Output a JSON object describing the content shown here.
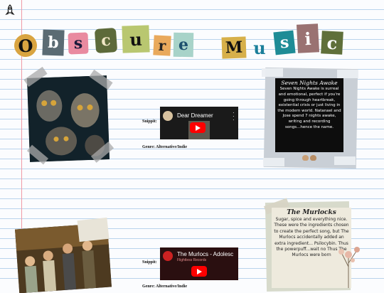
{
  "title": {
    "word1": [
      "O",
      "b",
      "s",
      "c",
      "u",
      "r",
      "e"
    ],
    "word2": [
      "M",
      "u",
      "s",
      "i",
      "c"
    ]
  },
  "entries": [
    {
      "snippet_label": "Snippit:",
      "genre_label": "Genre: Alternative/Indie",
      "video_title": "Dear Dreamer",
      "video_channel": "",
      "card_title": "Seven Nights Awake",
      "card_text": "Seven Nights Awake is surreal and emotional, perfect if you're going through heartbreak, existential crisis or just living in the modern world. Natanael and Jose spend 7 nights awake, writing and recording songs...hence the name."
    },
    {
      "snippet_label": "Snippit:",
      "genre_label": "Genre: Alternative/Indie",
      "video_title": "The Murlocs - Adolesc",
      "video_channel": "Flightless Records",
      "card_title": "The Murlocks",
      "card_text": "Sugar, spice and everything nice. These were the ingredients chosen to create the perfect song, but The Murlocs accidentally added an extra ingredient... Psilocybin. Thus the powerpuff...wait no Thus The Murlocs were born"
    }
  ],
  "colors": {
    "margin_line": "#f19aa6",
    "notebook_line": "#b9d3ec",
    "youtube_red": "#ff0000"
  },
  "icons": [
    "rocket-icon",
    "play-icon"
  ]
}
